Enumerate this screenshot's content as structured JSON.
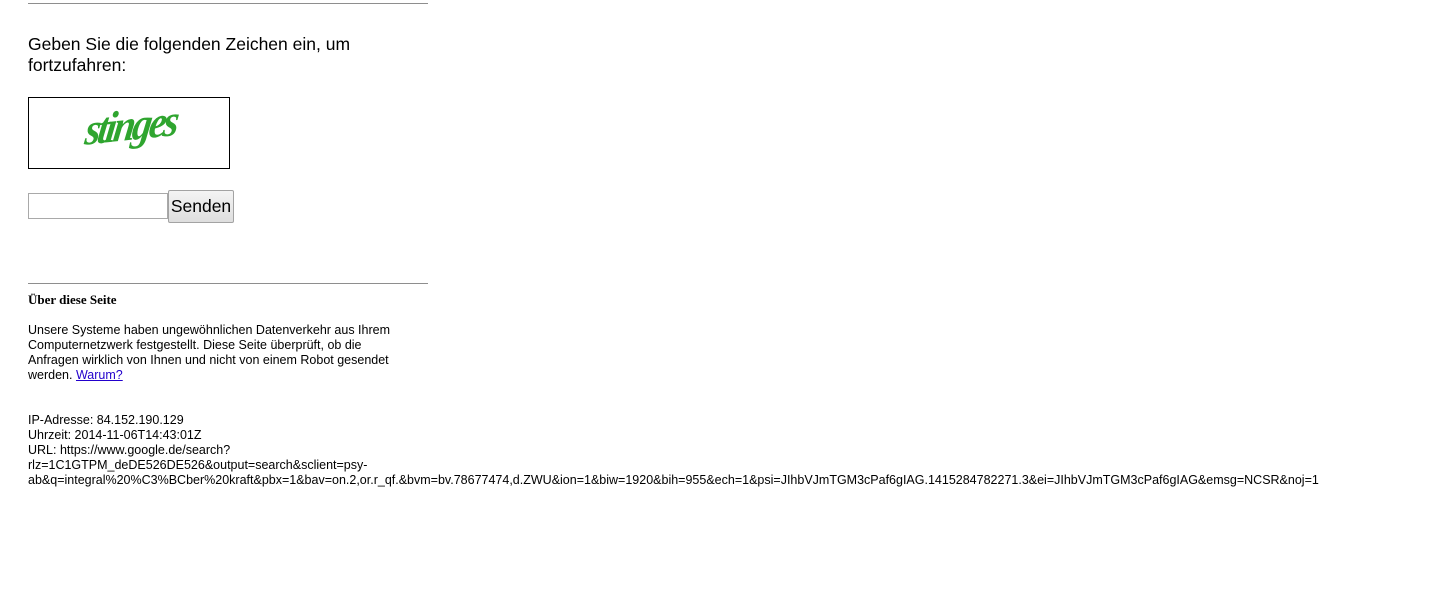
{
  "captcha": {
    "prompt": "Geben Sie die folgenden Zeichen ein, um fortzufahren:",
    "image_text": "stinges",
    "image_color": "#2fa52f",
    "input_value": "",
    "submit_label": "Senden"
  },
  "about": {
    "heading": "Über diese Seite",
    "text": "Unsere Systeme haben ungewöhnlichen Datenverkehr aus Ihrem Computernetzwerk festgestellt. Diese Seite überprüft, ob die Anfragen wirklich von Ihnen und nicht von einem Robot gesendet werden.",
    "why_link": "Warum?"
  },
  "info": {
    "ip_line": "IP-Adresse: 84.152.190.129",
    "time_line": "Uhrzeit: 2014-11-06T14:43:01Z",
    "url_line_1": "URL: https://www.google.de/search?",
    "url_line_2": "rlz=1C1GTPM_deDE526DE526&output=search&sclient=psy-",
    "url_line_3": "ab&q=integral%20%C3%BCber%20kraft&pbx=1&bav=on.2,or.r_qf.&bvm=bv.78677474,d.ZWU&ion=1&biw=1920&bih=955&ech=1&psi=JIhbVJmTGM3cPaf6gIAG.1415284782271.3&ei=JIhbVJmTGM3cPaf6gIAG&emsg=NCSR&noj=1"
  }
}
